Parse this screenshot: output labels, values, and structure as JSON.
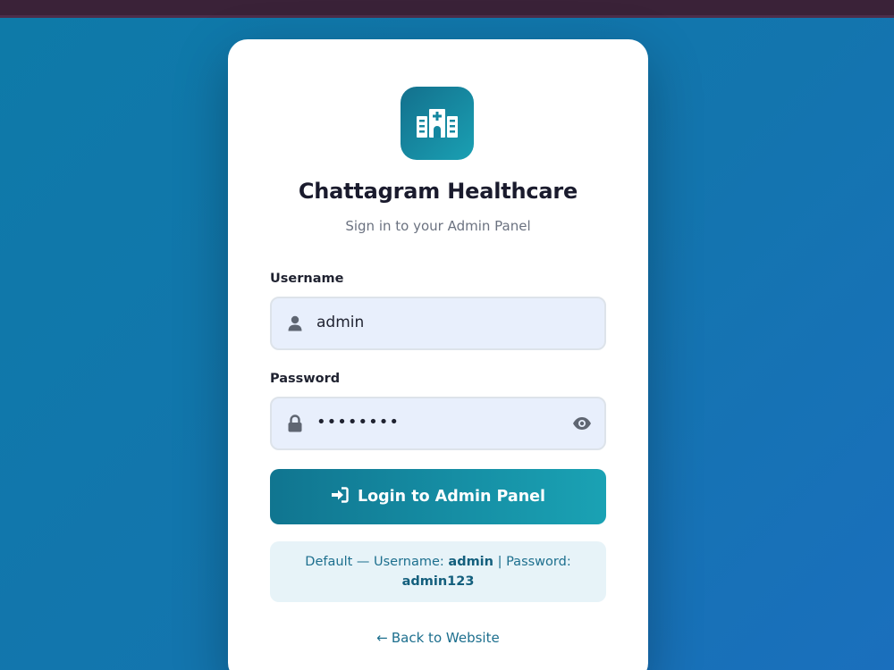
{
  "brand": {
    "title": "Chattagram Healthcare",
    "subtitle": "Sign in to your Admin Panel",
    "logo_icon": "hospital-icon"
  },
  "form": {
    "username_label": "Username",
    "username_value": "admin",
    "password_label": "Password",
    "password_value": "••••••••",
    "login_label": "Login to Admin Panel"
  },
  "hint": {
    "prefix": "Default — Username: ",
    "username": "admin",
    "separator": " | Password: ",
    "password": "admin123"
  },
  "back_link": {
    "arrow": "←",
    "label": "Back to Website"
  },
  "colors": {
    "accent": "#13708d",
    "accent_light": "#1aa0b3",
    "field_bg": "#e8effc",
    "topbar": "#3a2238"
  }
}
